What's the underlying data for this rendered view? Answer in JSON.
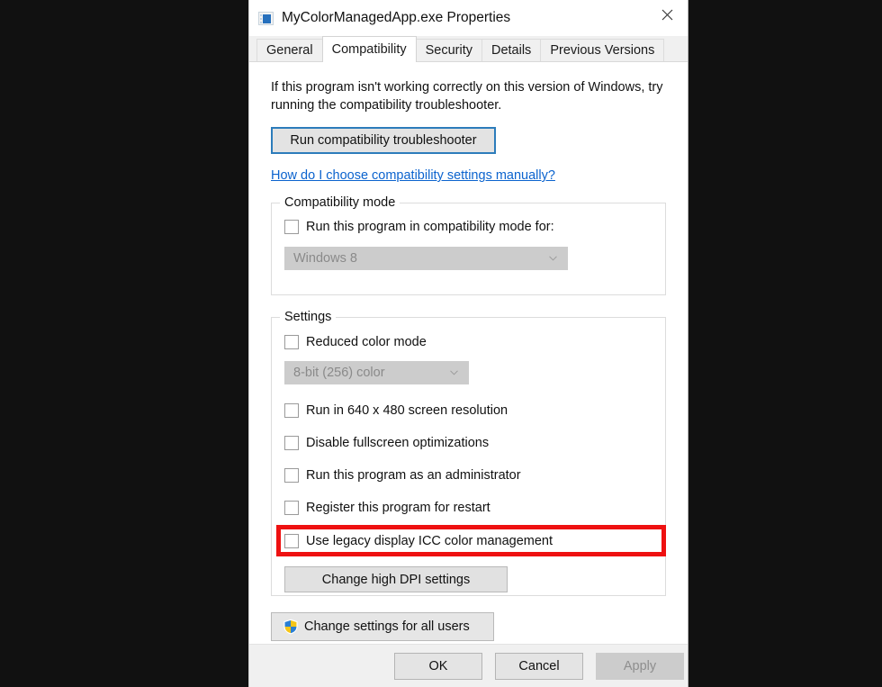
{
  "window": {
    "title": "MyColorManagedApp.exe Properties",
    "app_icon": "application-window-icon",
    "close_icon": "close-icon"
  },
  "tabs": [
    {
      "label": "General",
      "active": false
    },
    {
      "label": "Compatibility",
      "active": true
    },
    {
      "label": "Security",
      "active": false
    },
    {
      "label": "Details",
      "active": false
    },
    {
      "label": "Previous Versions",
      "active": false
    }
  ],
  "content": {
    "intro_text": "If this program isn't working correctly on this version of Windows, try running the compatibility troubleshooter.",
    "troubleshoot_button": "Run compatibility troubleshooter",
    "manual_link": "How do I choose compatibility settings manually?"
  },
  "compatibility_mode": {
    "group_title": "Compatibility mode",
    "checkbox_label": "Run this program in compatibility mode for:",
    "checkbox_checked": false,
    "combo_value": "Windows 8",
    "combo_enabled": false
  },
  "settings": {
    "group_title": "Settings",
    "reduced_color_label": "Reduced color mode",
    "reduced_color_checked": false,
    "color_depth_value": "8-bit (256) color",
    "color_depth_enabled": false,
    "checkboxes": [
      {
        "label": "Run in 640 x 480 screen resolution",
        "checked": false,
        "highlighted": false
      },
      {
        "label": "Disable fullscreen optimizations",
        "checked": false,
        "highlighted": false
      },
      {
        "label": "Run this program as an administrator",
        "checked": false,
        "highlighted": false
      },
      {
        "label": "Register this program for restart",
        "checked": false,
        "highlighted": false
      },
      {
        "label": "Use legacy display ICC color management",
        "checked": false,
        "highlighted": true
      }
    ],
    "dpi_button": "Change high DPI settings"
  },
  "all_users_button": {
    "label": "Change settings for all users",
    "icon": "uac-shield-icon"
  },
  "footer": {
    "ok": "OK",
    "cancel": "Cancel",
    "apply": "Apply",
    "apply_enabled": false
  },
  "colors": {
    "highlight_red": "#ee1111",
    "link_blue": "#0b63ce",
    "focus_blue": "#2c7cbb",
    "dialog_background": "#ffffff",
    "footer_background": "#f0f0f0",
    "desktop_background": "#111111"
  }
}
